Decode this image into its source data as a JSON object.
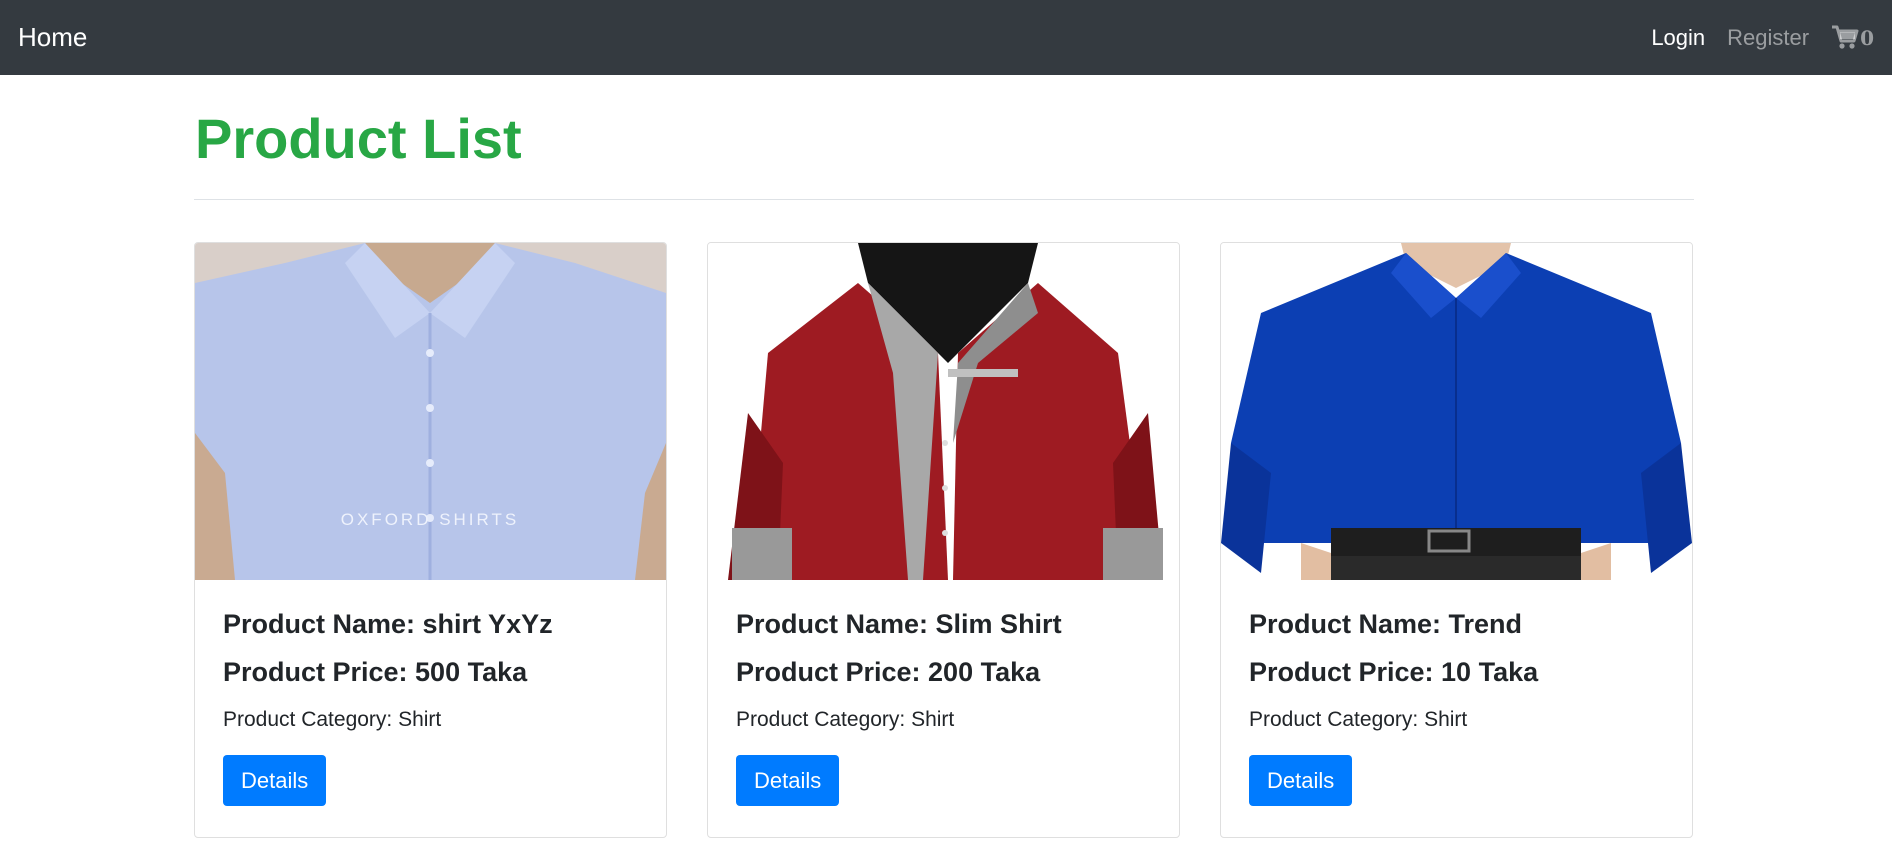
{
  "navbar": {
    "brand": "Home",
    "login": "Login",
    "register": "Register",
    "cart_count": "0",
    "cart_icon": "cart-icon"
  },
  "page": {
    "title": "Product List"
  },
  "products": [
    {
      "name_label": "Product Name: shirt YxYz",
      "price_label": "Product Price: 500 Taka",
      "category_label": "Product Category: Shirt",
      "button": "Details",
      "image": "light-blue-oxford-shirt-photo"
    },
    {
      "name_label": "Product Name: Slim Shirt",
      "price_label": "Product Price: 200 Taka",
      "category_label": "Product Category: Shirt",
      "button": "Details",
      "image": "red-slim-shirt-photo"
    },
    {
      "name_label": "Product Name: Trend",
      "price_label": "Product Price: 10 Taka",
      "category_label": "Product Category: Shirt",
      "button": "Details",
      "image": "blue-shirt-photo"
    }
  ],
  "image_text": {
    "oxford": "OXFORD SHIRTS"
  },
  "colors": {
    "navbar_bg": "#343a40",
    "title": "#28a745",
    "button": "#007bff"
  }
}
